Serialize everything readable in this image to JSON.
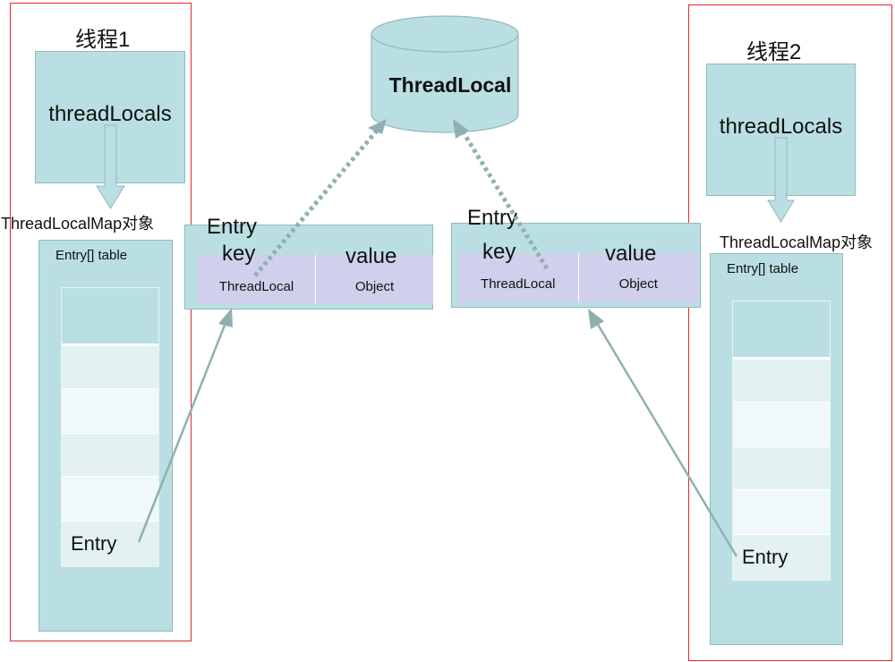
{
  "colors": {
    "box_fill": "#badfe2",
    "cell_fill": "#d0d0ec",
    "frame": "#e8262b",
    "arrow": "#8fb0b1"
  },
  "thread1": {
    "title": "线程1",
    "thread_locals": "threadLocals",
    "map_label": "ThreadLocalMap对象",
    "table_label": "Entry[] table",
    "entry_label": "Entry"
  },
  "thread2": {
    "title": "线程2",
    "thread_locals": "threadLocals",
    "map_label": "ThreadLocalMap对象",
    "table_label": "Entry[] table",
    "entry_label": "Entry"
  },
  "threadlocal": {
    "label": "ThreadLocal"
  },
  "entry1": {
    "title": "Entry",
    "key_label": "key",
    "value_label": "value",
    "key_type": "ThreadLocal",
    "value_type": "Object"
  },
  "entry2": {
    "title": "Entry",
    "key_label": "key",
    "value_label": "value",
    "key_type": "ThreadLocal",
    "value_type": "Object"
  }
}
